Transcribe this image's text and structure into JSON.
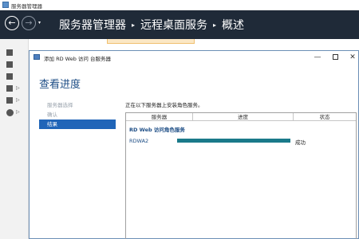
{
  "app": {
    "title": "服务器管理器"
  },
  "nav": {
    "back_glyph": "←",
    "forward_glyph": "→",
    "dropdown_glyph": "▾",
    "breadcrumb": [
      "服务器管理器",
      "远程桌面服务",
      "概述"
    ],
    "separator": "▸"
  },
  "left_rail": {
    "items": [
      {
        "icon": "dashboard-icon"
      },
      {
        "icon": "local-server-icon"
      },
      {
        "icon": "all-servers-icon"
      },
      {
        "icon": "file-storage-icon",
        "has_arrow": true,
        "arrow": "▷"
      },
      {
        "icon": "iis-icon",
        "has_arrow": true,
        "arrow": "▷"
      },
      {
        "icon": "remote-desktop-services-icon",
        "has_arrow": true,
        "arrow": "▷",
        "active": true
      }
    ]
  },
  "dialog": {
    "title": "添加 RD Web 访问 台服务器",
    "controls": {
      "minimize": "—",
      "close": "✕"
    },
    "heading": "查看进度",
    "steps": [
      {
        "label": "服务器选择",
        "state": "disabled"
      },
      {
        "label": "确认",
        "state": "disabled"
      },
      {
        "label": "结果",
        "state": "active"
      }
    ],
    "intro": "正在以下服务器上安装角色服务。",
    "table": {
      "columns": [
        "服务器",
        "进度",
        "状态"
      ],
      "group": "RD Web 访问角色服务",
      "rows": [
        {
          "server": "RDWA2",
          "progress": 1.0,
          "status": "成功"
        }
      ]
    }
  },
  "colors": {
    "nav_bg": "#1f2a38",
    "accent": "#2065b8",
    "heading": "#1e4e86",
    "progress": "#1a7a8a"
  }
}
